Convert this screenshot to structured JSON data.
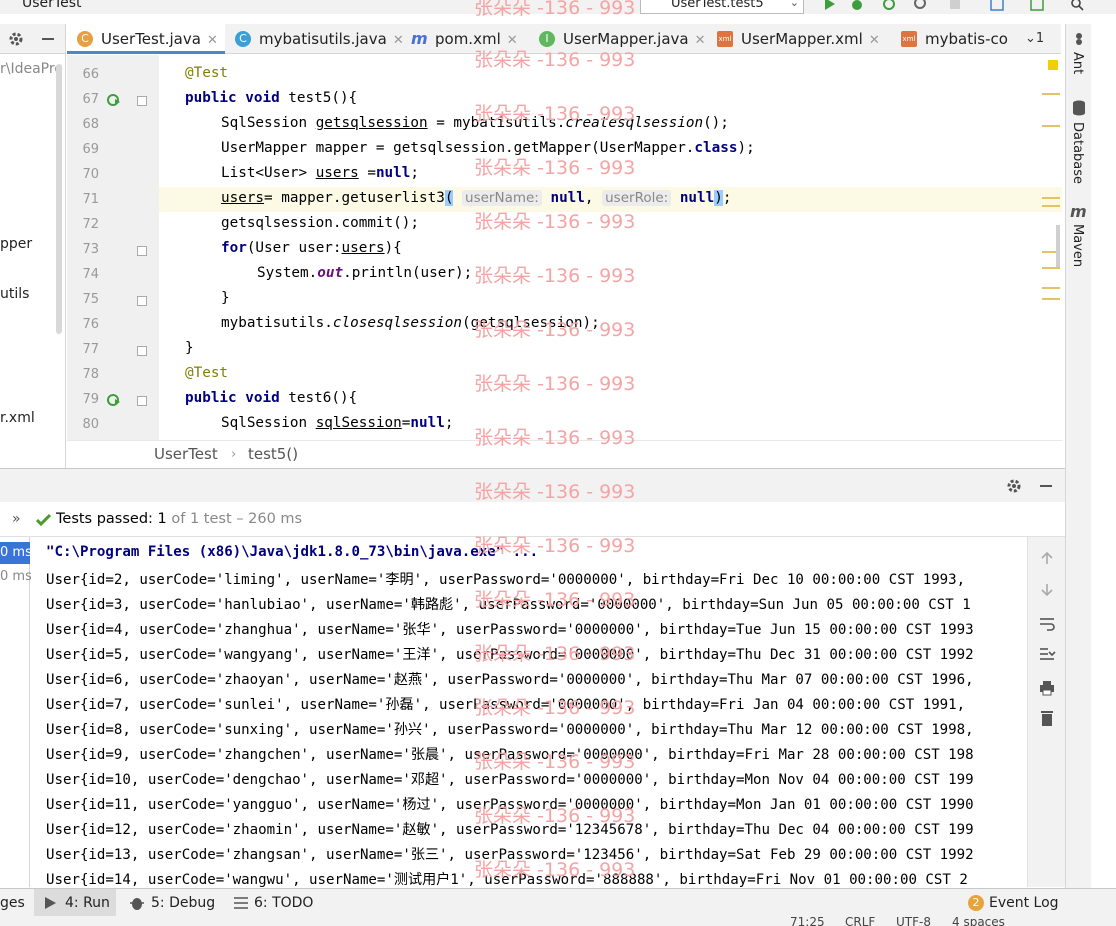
{
  "window": {
    "title": "UserTest",
    "run_config": "UserTest.test5"
  },
  "project_panel": {
    "path_fragment": "r\\IdeaPro",
    "items": [
      "pper",
      "utils",
      "r.xml"
    ]
  },
  "tabs": [
    {
      "label": "UserTest.java",
      "icon": "C",
      "color": "#e89e43",
      "active": true
    },
    {
      "label": "mybatisutils.java",
      "icon": "C",
      "color": "#3b9fd8",
      "active": false
    },
    {
      "label": "pom.xml",
      "icon": "m",
      "color": "#4a6fd8",
      "active": false
    },
    {
      "label": "UserMapper.java",
      "icon": "I",
      "color": "#5fb85f",
      "active": false
    },
    {
      "label": "UserMapper.xml",
      "icon": "xml",
      "color": "#e0743f",
      "active": false
    },
    {
      "label": "mybatis-co",
      "icon": "xml",
      "color": "#e0743f",
      "active": false
    }
  ],
  "tabs_overflow": "1",
  "editor": {
    "line_numbers": [
      "66",
      "67",
      "68",
      "69",
      "70",
      "71",
      "72",
      "73",
      "74",
      "75",
      "76",
      "77",
      "78",
      "79",
      "80"
    ],
    "code": {
      "l66_ann": "@Test",
      "l67_kw": "public void ",
      "l67_rest": "test5(){",
      "l68_a": "SqlSession ",
      "l68_var": "getsqlsession",
      "l68_b": " = mybatisutils.",
      "l68_call": "createsqlsession",
      "l68_c": "();",
      "l69_a": "UserMapper mapper = getsqlsession.getMapper(UserMapper.",
      "l69_kw": "class",
      "l69_b": ");",
      "l70_a": "List<User> ",
      "l70_var": "users",
      "l70_b": " =",
      "l70_kw": "null",
      "l70_c": ";",
      "l71_var": "users",
      "l71_a": "= mapper.getuserlist3",
      "l71_paren_open": "(",
      "l71_hint1": "userName:",
      "l71_kw1": "null",
      "l71_comma": ", ",
      "l71_hint2": "userRole:",
      "l71_kw2": "null",
      "l71_paren_close": ")",
      "l71_end": ";",
      "l72": "getsqlsession.commit();",
      "l73_kw": "for",
      "l73_a": "(User user:",
      "l73_var": "users",
      "l73_b": "){",
      "l74_a": "System.",
      "l74_out": "out",
      "l74_b": ".println(user);",
      "l75": "}",
      "l76_a": "mybatisutils.",
      "l76_call": "closesqlsession",
      "l76_b": "(getsqlsession);",
      "l77": "}",
      "l78_ann": "@Test",
      "l79_kw": "public void ",
      "l79_rest": "test6(){",
      "l80_a": "SqlSession ",
      "l80_var": "sqlSession",
      "l80_b": "=",
      "l80_kw": "null",
      "l80_c": ";"
    }
  },
  "right_tools": [
    "Ant",
    "Database",
    "Maven"
  ],
  "breadcrumb": [
    "UserTest",
    "test5()"
  ],
  "run": {
    "status_prefix": "Tests passed: ",
    "passed": "1",
    "status_suffix": " of 1 test – 260 ms",
    "tree_selected": "0 ms",
    "tree_second": "0 ms",
    "console_lines": [
      "\"C:\\Program Files (x86)\\Java\\jdk1.8.0_73\\bin\\java.exe\" ...",
      "User{id=2, userCode='liming', userName='李明', userPassword='0000000', birthday=Fri Dec 10 00:00:00 CST 1993,",
      "User{id=3, userCode='hanlubiao', userName='韩路彪', userPassword='0000000', birthday=Sun Jun 05 00:00:00 CST 1",
      "User{id=4, userCode='zhanghua', userName='张华', userPassword='0000000', birthday=Tue Jun 15 00:00:00 CST 1993",
      "User{id=5, userCode='wangyang', userName='王洋', userPassword='0000000', birthday=Thu Dec 31 00:00:00 CST 1992",
      "User{id=6, userCode='zhaoyan', userName='赵燕', userPassword='0000000', birthday=Thu Mar 07 00:00:00 CST 1996,",
      "User{id=7, userCode='sunlei', userName='孙磊', userPassword='0000000', birthday=Fri Jan 04 00:00:00 CST 1991,",
      "User{id=8, userCode='sunxing', userName='孙兴', userPassword='0000000', birthday=Thu Mar 12 00:00:00 CST 1998,",
      "User{id=9, userCode='zhangchen', userName='张晨', userPassword='0000000', birthday=Fri Mar 28 00:00:00 CST 198",
      "User{id=10, userCode='dengchao', userName='邓超', userPassword='0000000', birthday=Mon Nov 04 00:00:00 CST 199",
      "User{id=11, userCode='yangguo', userName='杨过', userPassword='0000000', birthday=Mon Jan 01 00:00:00 CST 1990",
      "User{id=12, userCode='zhaomin', userName='赵敏', userPassword='12345678', birthday=Thu Dec 04 00:00:00 CST 199",
      "User{id=13, userCode='zhangsan', userName='张三', userPassword='123456', birthday=Sat Feb 29 00:00:00 CST 1992",
      "User{id=14, userCode='wangwu', userName='测试用户1', userPassword='888888', birthday=Fri Nov 01 00:00:00 CST 2"
    ]
  },
  "bottom_bar": {
    "left_fragment": "ges",
    "run": "4: Run",
    "debug": "5: Debug",
    "todo": "6: TODO",
    "event_log_count": "2",
    "event_log": "Event Log"
  },
  "status_bar": {
    "position": "71:25",
    "line_sep": "CRLF",
    "encoding": "UTF-8",
    "indent": "4 spaces"
  },
  "watermark": "张朵朵 -136 - 993",
  "colors": {
    "accent": "#4a88c7",
    "pass": "#4c9a2a",
    "selection": "#3875d7",
    "caret_line": "#fcfae5",
    "watermark": "#f4a4a4"
  }
}
